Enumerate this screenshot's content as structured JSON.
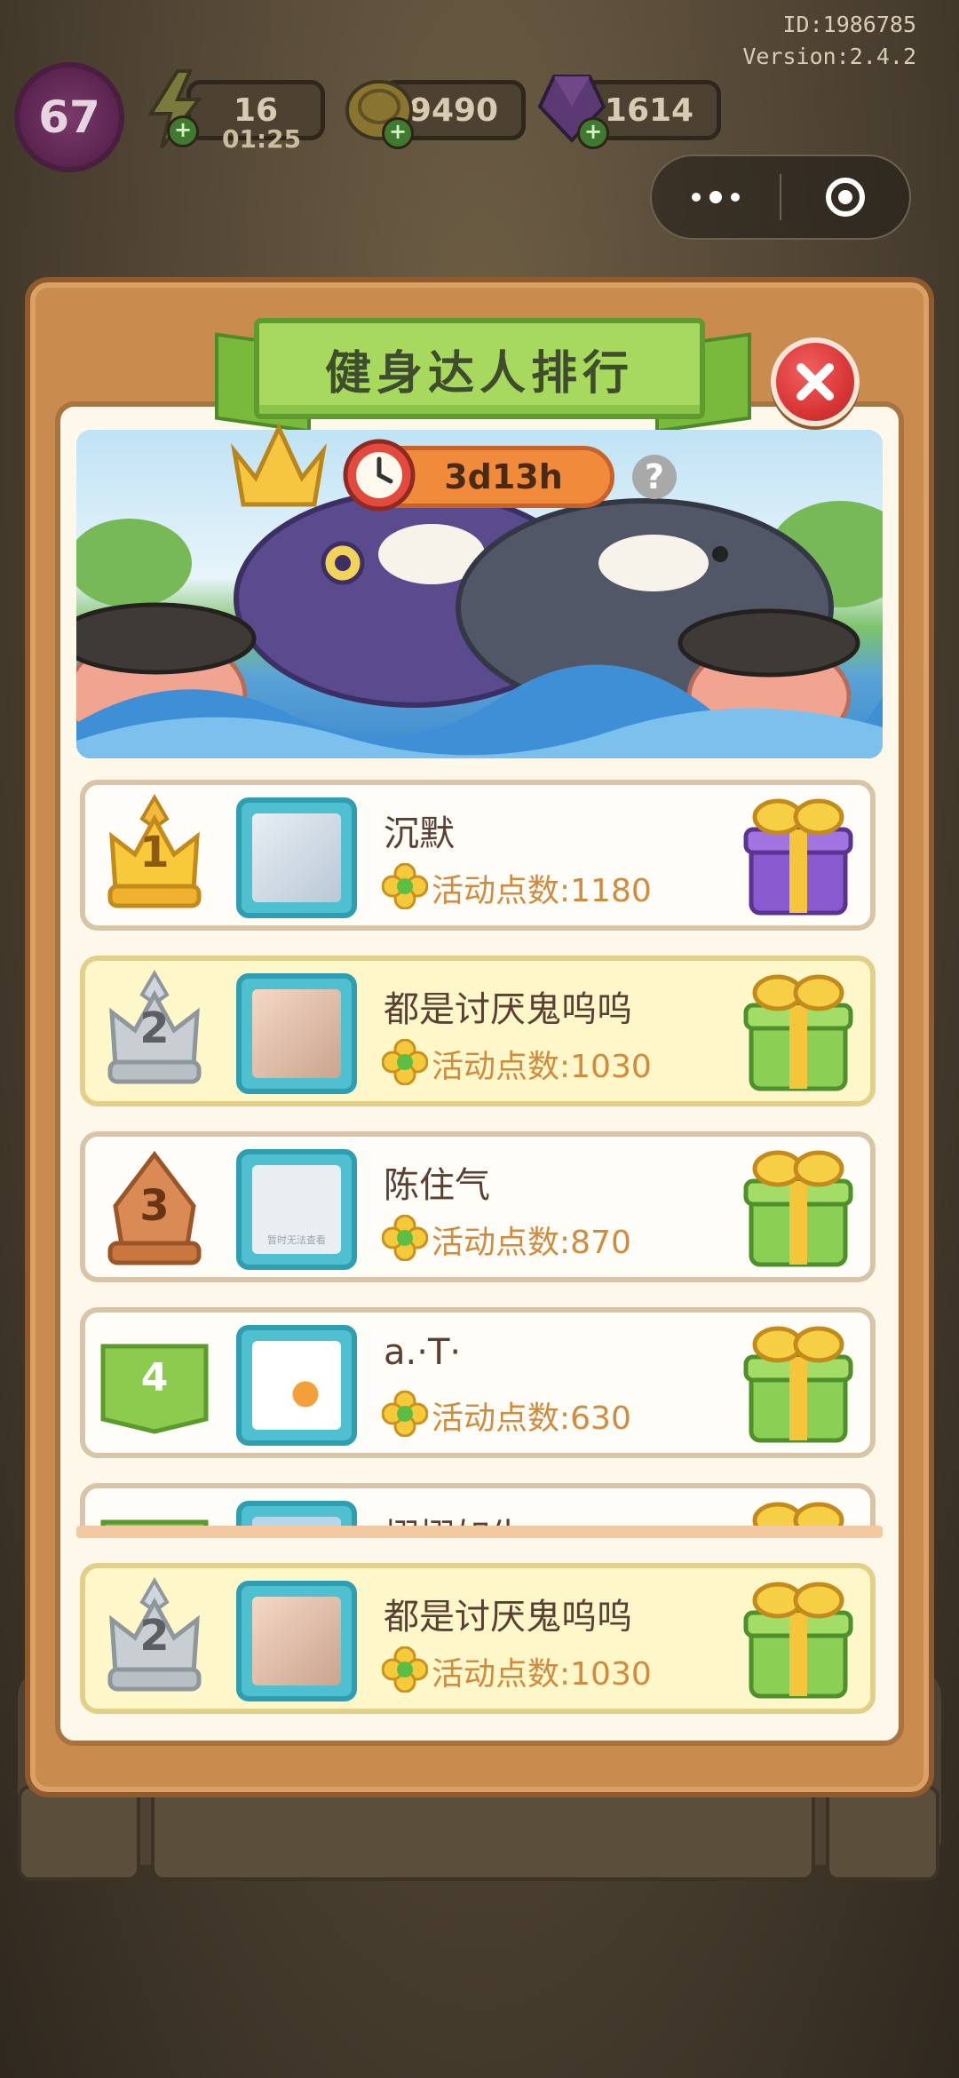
{
  "hud": {
    "id_text": "ID:1986785",
    "version_text": "Version:2.4.2",
    "level": "67",
    "energy": "16",
    "energy_timer": "01:25",
    "coins": "9490",
    "gems": "1614"
  },
  "modal": {
    "title": "健身达人排行",
    "countdown": "3d13h",
    "help": "?"
  },
  "ranking": [
    {
      "rank": "1",
      "name": "沉默",
      "points_label": "活动点数:1180",
      "highlight": false
    },
    {
      "rank": "2",
      "name": "都是讨厌鬼呜呜",
      "points_label": "活动点数:1030",
      "highlight": true
    },
    {
      "rank": "3",
      "name": "陈住气",
      "points_label": "活动点数:870",
      "highlight": false
    },
    {
      "rank": "4",
      "name": "a.·T·",
      "points_label": "活动点数:630",
      "highlight": false
    },
    {
      "rank": "",
      "name": "栩栩如生",
      "points_label": "",
      "highlight": false
    }
  ],
  "avatar_placeholder_text": "暂时无法查看",
  "my_entry": {
    "rank": "2",
    "name": "都是讨厌鬼呜呜",
    "points_label": "活动点数:1030"
  },
  "colors": {
    "modal_frame": "#c98b4e",
    "ribbon_green": "#a6d95e",
    "close_red": "#d93636",
    "points_orange": "#d08b3f",
    "highlight_row": "#fdf7c9"
  },
  "icons": [
    "crown-icon",
    "clock-icon",
    "help-icon",
    "close-icon",
    "flower-icon",
    "gift-icon",
    "energy-icon",
    "coin-icon",
    "gem-icon"
  ]
}
